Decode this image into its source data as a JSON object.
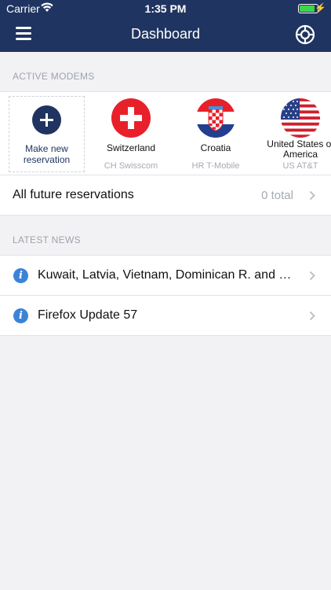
{
  "status_bar": {
    "carrier": "Carrier",
    "time": "1:35 PM",
    "battery_level": 0.9
  },
  "nav": {
    "title": "Dashboard"
  },
  "sections": {
    "active_modems": "ACTIVE MODEMS",
    "latest_news": "LATEST NEWS"
  },
  "new_reservation": {
    "label": "Make new reservation"
  },
  "modems": [
    {
      "country": "Switzerland",
      "provider": "CH Swisscom"
    },
    {
      "country": "Croatia",
      "provider": "HR T-Mobile"
    },
    {
      "country": "United States of America",
      "provider": "US AT&T"
    }
  ],
  "future_reservations": {
    "label": "All future reservations",
    "count": "0 total"
  },
  "news": [
    {
      "title": "Kuwait, Latvia, Vietnam, Dominican R. and Chile"
    },
    {
      "title": "Firefox Update 57"
    }
  ],
  "colors": {
    "navy": "#1f3460",
    "info_blue": "#3c83d7",
    "battery_green": "#3cd64a"
  }
}
